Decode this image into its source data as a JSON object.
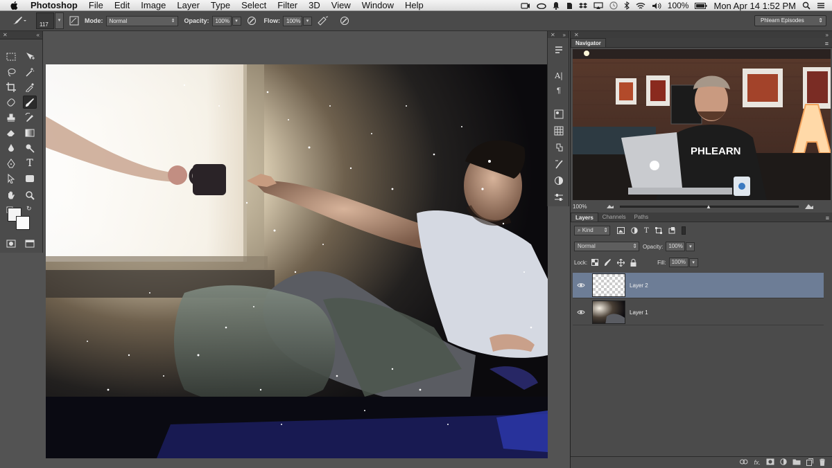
{
  "menubar": {
    "app_name": "Photoshop",
    "menus": [
      "File",
      "Edit",
      "Image",
      "Layer",
      "Type",
      "Select",
      "Filter",
      "3D",
      "View",
      "Window",
      "Help"
    ],
    "battery": "100%",
    "datetime": "Mon Apr 14  1:52 PM"
  },
  "options_bar": {
    "brush_size": "117",
    "mode_label": "Mode:",
    "mode_value": "Normal",
    "opacity_label": "Opacity:",
    "opacity_value": "100%",
    "flow_label": "Flow:",
    "flow_value": "100%",
    "workspace": "Phlearn Episodes"
  },
  "navigator": {
    "tab": "Navigator",
    "zoom": "100%",
    "shirt_text": "PHLEARN",
    "sign_letter": "A"
  },
  "layers_panel": {
    "tabs": [
      "Layers",
      "Channels",
      "Paths"
    ],
    "filter_kind": "Kind",
    "blend_mode": "Normal",
    "opacity_label": "Opacity:",
    "opacity_value": "100%",
    "lock_label": "Lock:",
    "fill_label": "Fill:",
    "fill_value": "100%",
    "layers": [
      {
        "name": "Layer 2",
        "selected": true
      },
      {
        "name": "Layer 1",
        "selected": false
      }
    ],
    "footer_fx": "fx."
  },
  "colors": {
    "panel_bg": "#4b4b4b",
    "selected_layer": "#6d7d96",
    "menubar_bg": "#e9e9e9"
  }
}
